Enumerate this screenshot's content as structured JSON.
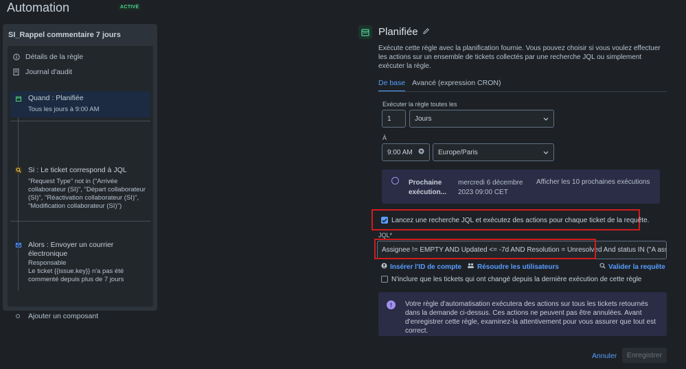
{
  "header": {
    "title": "Automation",
    "status": "ACTIVÉ"
  },
  "sidebar": {
    "rule_name": "SI_Rappel commentaire 7 jours",
    "links": [
      {
        "label": "Détails de la règle",
        "icon": "info-icon"
      },
      {
        "label": "Journal d'audit",
        "icon": "document-icon"
      }
    ],
    "steps": {
      "when": {
        "title": "Quand : Planifiée",
        "body": "Tous les jours à 9:00 AM",
        "icon": "calendar-icon"
      },
      "if": {
        "title": "Si : Le ticket correspond à JQL",
        "lines": [
          "\"Request Type\" not in (\"Arrivée",
          "collaborateur (SI)\", \"Départ collaborateur",
          "(SI)\", \"Réactivation collaborateur (SI)\",",
          "\"Modification collaborateur (SI)\")"
        ],
        "icon": "search-icon"
      },
      "then": {
        "title_lines": [
          "Alors : Envoyer un courrier",
          "électronique"
        ],
        "lines": [
          "Responsable",
          "Le ticket {{issue.key}} n'a pas été",
          "commenté depuis plus de 7 jours"
        ],
        "icon": "mail-icon"
      },
      "add": {
        "label": "Ajouter un composant"
      }
    }
  },
  "panel": {
    "title": "Planifiée",
    "description": "Exécute cette règle avec la planification fournie. Vous pouvez choisir si vous voulez effectuer les actions sur un ensemble de tickets collectés par une recherche JQL ou simplement exécuter la règle.",
    "tabs": [
      {
        "label": "De base",
        "active": true
      },
      {
        "label": "Avancé (expression CRON)",
        "active": false
      }
    ],
    "interval": {
      "label": "Exécuter la règle toutes les",
      "value": "1",
      "unit": "Jours"
    },
    "at": {
      "label": "À",
      "time": "9:00 AM",
      "timezone": "Europe/Paris"
    },
    "next_run": {
      "label_line1": "Prochaine",
      "label_line2": "exécution...",
      "date_line1": "mercredi 6 décembre",
      "date_line2": "2023 09:00 CET",
      "link": "Afficher les 10 prochaines exécutions"
    },
    "jql_checkbox": {
      "label": "Lancez une recherche JQL et exécutez des actions pour chaque ticket de la requête.",
      "checked": true
    },
    "jql": {
      "label": "JQL",
      "required_mark": "*",
      "value": "Assignee != EMPTY AND Updated <= -7d AND Resolution = Unresolved And status IN (\"A assigner\""
    },
    "jql_links": {
      "insert_id": "Insérer l'ID de compte",
      "resolve_users": "Résoudre les utilisateurs",
      "validate": "Valider la requête"
    },
    "only_changed": {
      "label": "N'inclure que les tickets qui ont changé depuis la dernière exécution de cette règle",
      "checked": false
    },
    "warning": "Votre règle d'automatisation exécutera des actions sur tous les tickets retournés dans la demande ci-dessus. Ces actions ne peuvent pas être annulées. Avant d'enregistrer cette règle, examinez-la attentivement pour vous assurer que tout est correct.",
    "buttons": {
      "cancel": "Annuler",
      "save": "Enregistrer"
    }
  },
  "colors": {
    "background": "#1d2125",
    "accent": "#579dff",
    "highlight_border": "#d21c1c",
    "active_badge": "#4bce97"
  }
}
